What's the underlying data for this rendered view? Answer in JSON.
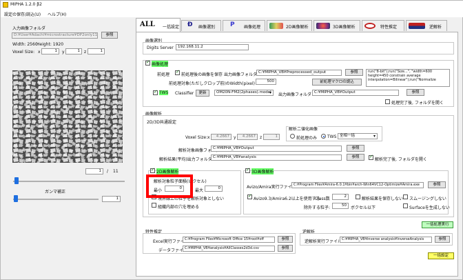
{
  "window": {
    "title": "MIPHA 1.2.0 β2"
  },
  "menu": {
    "settings": "設定の保存/読込(U)",
    "help": "ヘルプ(H)"
  },
  "left": {
    "input_folder_label": "入力画像フォルダ",
    "input_folder_value": "D:¥User¥Adachi¥microstracture¥DP2only11",
    "browse": "参照",
    "width_text": "Width: 2560",
    "height_text": "Height: 1920",
    "voxel_label": "Voxel Size:",
    "x_label": "x",
    "x_value": "1",
    "y_label": "y",
    "y_value": "1",
    "z_label": "z",
    "z_value": "1",
    "frame_value": "1",
    "frame_sep": "/",
    "frame_total": "11",
    "gamma_label": "ガンマ補正",
    "gamma_value": "1",
    "slider1_level": 0.03,
    "slider2_level": 0.03
  },
  "tabs": [
    {
      "label": "一括設定",
      "icon": "all-logo-icon"
    },
    {
      "label": "画像選別",
      "icon": "d-logo-icon"
    },
    {
      "label": "画像処理",
      "icon": "p-logo-icon"
    },
    {
      "label": "2D画像解析",
      "icon": "2d-image-icon"
    },
    {
      "label": "3D画像解析",
      "icon": "3d-image-icon"
    },
    {
      "label": "特性推定",
      "icon": "prediction-icon"
    },
    {
      "label": "逆解析",
      "icon": "inverse-logo-icon"
    }
  ],
  "all_logo_text": "ALL",
  "selection": {
    "header": "画像選別",
    "server_label": "Digits Server",
    "server_value": "192.168.11.2"
  },
  "processing": {
    "checkbox_label": "画像処理",
    "pre_label": "前処理",
    "save_pre_label": "前処理後の画像を保存",
    "output_folder_label": "出力画像フォルダ",
    "output_folder_value": "C:¥MIPHA_VB¥Preprocessed_output",
    "browse": "参照",
    "crop_label": "前処理対象(ただしクロップ前)のWidth(pixel)",
    "crop_value": "500",
    "macro_button": "前処理マクロの読込",
    "macro_text": "run(\"8-bit\");run(\"Size...\", \"width=600 height=450 constrain average interpolation=Bilinear\");run(\"Normalize",
    "tws_label": "TWS",
    "classifier_label": "Classifier",
    "update_button": "更新",
    "classifier_value": "OM20N-FM2(2phases).model",
    "tws_output_label": "出力画像フォルダ",
    "tws_output_value": "C:¥MIPHA_VB¥Output",
    "tws_browse": "参照",
    "open_on_finish": "処理完了後, フォルダを開く"
  },
  "analysis": {
    "header": "画像解析",
    "common_header": "2D/3D共通設定",
    "voxel_label": "Voxel Size:",
    "vx_label": "x",
    "vx_value": "4.2667",
    "vy_label": "y",
    "vy_value": "4.2667",
    "vz_label": "z",
    "vz_value": "1",
    "binarize_label": "解析二値化画像",
    "radio_pre_only": "前処理のみ",
    "radio_tws": "TWS",
    "phase_value": "全相一括",
    "target_folder_label": "解析対象画像フォルダ",
    "target_folder_value": "C:¥MIPHA_VB¥Output",
    "result_folder_label": "解析結果(平均)出力フォルダ",
    "result_folder_value": "C:¥MIPHA_VB¥analysis",
    "browse1": "参照",
    "browse2": "参照",
    "open_on_finish": "解析完了後, フォルダを開く",
    "two_d_label": "2D画像解析",
    "area_label": "解析対象粒子面積(ピクセル)",
    "min_label": "最小",
    "min_value": "0",
    "max_label": "最大",
    "max_value": "0",
    "edge_label": "境界線上の粒子を解析対象としない",
    "fill_label": "組織内部の穴を埋める",
    "three_d_label": "3D画像解析",
    "avizo_label": "Avizo/Amira実行ファイル",
    "avizo_value": "C:¥Program Files¥Amira-6.0.1¥bin¥arch-Win64VC12-Optimize¥Amira.exe",
    "avizo_browse": "参照",
    "avizo_check": "Avizo9.3/Amira6.2以上を使用する",
    "class_label": "Class数",
    "class_value": "2",
    "no_save_label": "解析結果を保存しない",
    "smooth_label": "スムージングしない",
    "exclude_label": "除外する粒子:",
    "exclude_value": "50",
    "exclude_unit": "ボクセル以下",
    "surface_label": "Surfaceを生成しない",
    "run_all": "一括処理実行"
  },
  "property": {
    "header": "特性推定",
    "excel_label": "Excel実行ファイル",
    "excel_value": "C:¥Program Files¥Microsoft Office 15¥root¥off",
    "excel_browse": "参照",
    "data_label": "データファイル",
    "data_value": "C:¥MIPHA_VB¥analysis¥AllClasses2d3d.csv",
    "data_browse": "参照"
  },
  "inverse": {
    "header": "逆解析",
    "exe_label": "逆解析実行ファイル",
    "exe_value": "C:¥MIPHA_VB¥inverse analysis¥InverseAnalysis",
    "browse": "参照"
  },
  "bulk_setting_button": "一括設定",
  "colors": {
    "accent_red": "#ff0000",
    "green_label": "#66ff66",
    "yellow_button": "#ffff66",
    "slider_blue": "#1e6fe0"
  }
}
